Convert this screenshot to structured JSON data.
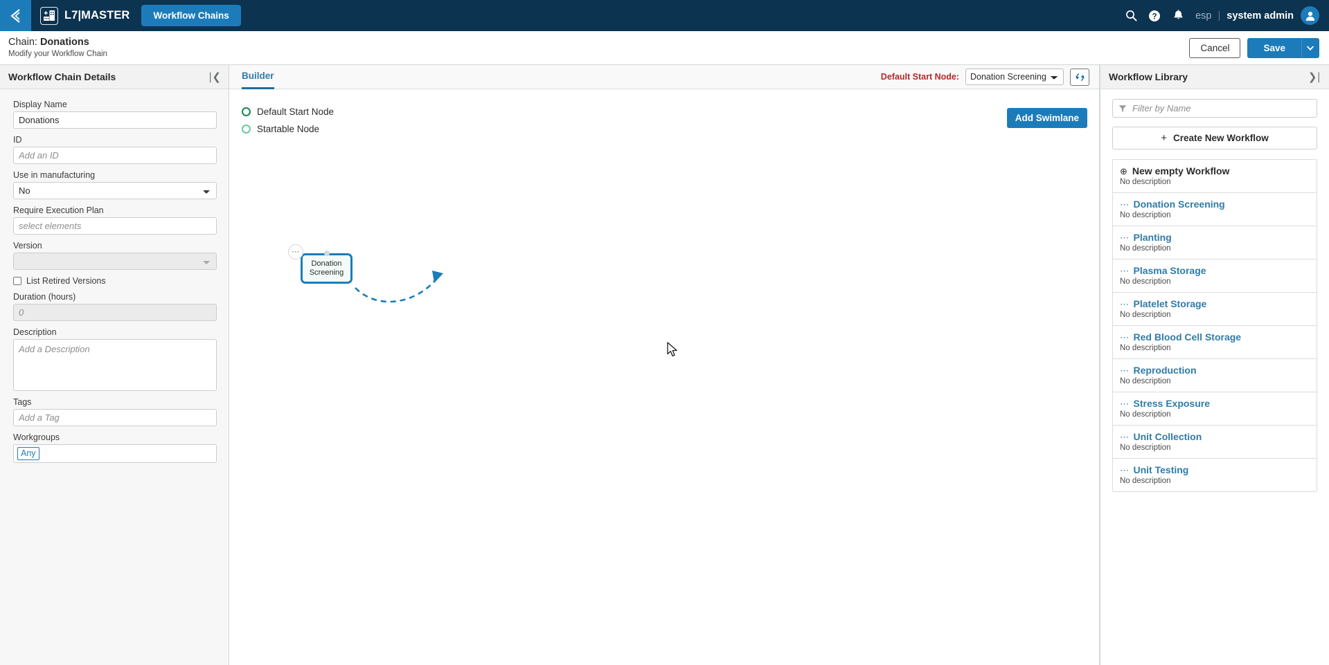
{
  "topnav": {
    "back_icon": "chevron-left-icon",
    "logo_icon": "lab-building-icon",
    "brand": "L7|MASTER",
    "active_tab": "Workflow Chains",
    "search_icon": "search-icon",
    "help_icon": "help-circle-icon",
    "notifications_icon": "bell-icon",
    "language": "esp",
    "separator": "|",
    "user": "system admin",
    "avatar_icon": "user-avatar-icon",
    "brand_color": "#1c7cba",
    "bar_color": "#0c3350"
  },
  "pagehead": {
    "title_prefix": "Chain: ",
    "title_name": "Donations",
    "subtitle": "Modify your Workflow Chain",
    "cancel_label": "Cancel",
    "save_label": "Save",
    "save_caret_icon": "chevron-down-icon"
  },
  "left_panel": {
    "title": "Workflow Chain Details",
    "collapse_icon": "collapse-left-icon",
    "fields": {
      "display_name_label": "Display Name",
      "display_name_value": "Donations",
      "id_label": "ID",
      "id_placeholder": "Add an ID",
      "id_value": "",
      "use_in_manufacturing_label": "Use in manufacturing",
      "use_in_manufacturing_value": "No",
      "require_execution_plan_label": "Require Execution Plan",
      "require_execution_plan_placeholder": "select elements",
      "require_execution_plan_value": "",
      "version_label": "Version",
      "version_value": "",
      "list_retired_label": "List Retired Versions",
      "list_retired_checked": false,
      "duration_label": "Duration (hours)",
      "duration_value": "",
      "duration_placeholder": "0",
      "description_label": "Description",
      "description_placeholder": "Add a Description",
      "description_value": "",
      "tags_label": "Tags",
      "tags_placeholder": "Add a Tag",
      "tags_value": "",
      "workgroups_label": "Workgroups",
      "workgroup_chip": "Any"
    }
  },
  "builder": {
    "tab_label": "Builder",
    "start_node_label": "Default Start Node:",
    "start_node_label_color": "#b32a2a",
    "start_node_value": "Donation Screening",
    "refresh_icon": "refresh-sync-icon",
    "legend": [
      {
        "label": "Default Start Node",
        "color": "#17874f"
      },
      {
        "label": "Startable Node",
        "color": "#6fc79b"
      }
    ],
    "add_swimlane_label": "Add Swimlane",
    "node": {
      "label_line1": "Donation",
      "label_line2": "Screening",
      "menu_icon": "ellipsis-icon",
      "border_color": "#1c7cba",
      "fill_color": "#f3fbf8"
    },
    "edge": {
      "style": "dashed",
      "color": "#1c7cba",
      "arrow_icon": "arrow-head-icon"
    },
    "cursor_icon": "mouse-pointer-icon"
  },
  "right_panel": {
    "title": "Workflow Library",
    "collapse_icon": "collapse-right-icon",
    "filter_icon": "filter-funnel-icon",
    "filter_placeholder": "Filter by Name",
    "filter_value": "",
    "create_label": "Create New Workflow",
    "create_icon": "plus-icon",
    "items": [
      {
        "icon": "plus-circle-icon",
        "name": "New empty Workflow",
        "desc": "No description",
        "style": "plain"
      },
      {
        "icon": "ellipsis-icon",
        "name": "Donation Screening",
        "desc": "No description",
        "style": "link"
      },
      {
        "icon": "ellipsis-icon",
        "name": "Planting",
        "desc": "No description",
        "style": "link"
      },
      {
        "icon": "ellipsis-icon",
        "name": "Plasma Storage",
        "desc": "No description",
        "style": "link"
      },
      {
        "icon": "ellipsis-icon",
        "name": "Platelet Storage",
        "desc": "No description",
        "style": "link"
      },
      {
        "icon": "ellipsis-icon",
        "name": "Red Blood Cell Storage",
        "desc": "No description",
        "style": "link"
      },
      {
        "icon": "ellipsis-icon",
        "name": "Reproduction",
        "desc": "No description",
        "style": "link"
      },
      {
        "icon": "ellipsis-icon",
        "name": "Stress Exposure",
        "desc": "No description",
        "style": "link"
      },
      {
        "icon": "ellipsis-icon",
        "name": "Unit Collection",
        "desc": "No description",
        "style": "link"
      },
      {
        "icon": "ellipsis-icon",
        "name": "Unit Testing",
        "desc": "No description",
        "style": "link"
      }
    ]
  }
}
